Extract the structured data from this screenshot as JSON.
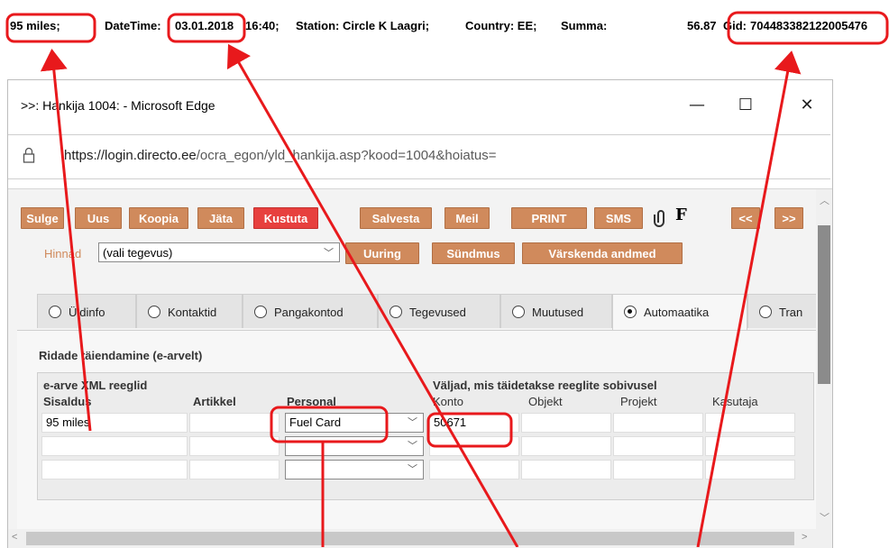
{
  "info_line": {
    "product": "95 miles;",
    "datetime_label": "DateTime:",
    "date": "03.01.2018",
    "time": "16:40;",
    "station": "Station: Circle K Laagri;",
    "country": "Country: EE;",
    "summa_label": "Summa:",
    "summa_value": "56.87",
    "gid_label": "Gid:",
    "gid_value": "704483382122005476"
  },
  "window": {
    "title": ">>: Hankija 1004: - Microsoft Edge",
    "url_host": "https://login.directo.ee",
    "url_path": "/ocra_egon/yld_hankija.asp?kood=1004&hoiatus=",
    "minimize": "—",
    "maximize": "☐",
    "close": "✕"
  },
  "toolbar": {
    "buttons": [
      "Sulge",
      "Uus",
      "Koopia",
      "Jäta",
      "Kustuta",
      "Salvesta",
      "Meil",
      "PRINT",
      "SMS"
    ],
    "attach_icon": "paperclip-icon",
    "f_label": "F",
    "nav_prev": "<<",
    "nav_next": ">>",
    "hinnad_label": "Hinnad",
    "action_select": "(vali tegevus)",
    "uuring": "Uuring",
    "sundmus": "Sündmus",
    "varskenda": "Värskenda andmed",
    "colors": {
      "button": "#d08a5c",
      "delete": "#e7403e"
    }
  },
  "tabs": [
    {
      "label": "Üldinfo",
      "selected": false
    },
    {
      "label": "Kontaktid",
      "selected": false
    },
    {
      "label": "Pangakontod",
      "selected": false
    },
    {
      "label": "Tegevused",
      "selected": false
    },
    {
      "label": "Muutused",
      "selected": false
    },
    {
      "label": "Automaatika",
      "selected": true
    },
    {
      "label": "Tran",
      "selected": false
    }
  ],
  "section": {
    "title": "Ridade täiendamine (e-arvelt)",
    "group_left": "e-arve XML reeglid",
    "group_right": "Väljad, mis täidetakse reeglite sobivusel",
    "columns": [
      "Sisaldus",
      "Artikkel",
      "Personal",
      "Konto",
      "Objekt",
      "Projekt",
      "Kasutaja"
    ],
    "rows": [
      {
        "sisaldus": "95 miles",
        "artikkel": "",
        "personal": "Fuel Card",
        "konto": "50671",
        "objekt": "",
        "projekt": "",
        "kasutaja": ""
      },
      {
        "sisaldus": "",
        "artikkel": "",
        "personal": "",
        "konto": "",
        "objekt": "",
        "projekt": "",
        "kasutaja": ""
      },
      {
        "sisaldus": "",
        "artikkel": "",
        "personal": "",
        "konto": "",
        "objekt": "",
        "projekt": "",
        "kasutaja": ""
      }
    ]
  },
  "annotation_color": "#e8191c"
}
